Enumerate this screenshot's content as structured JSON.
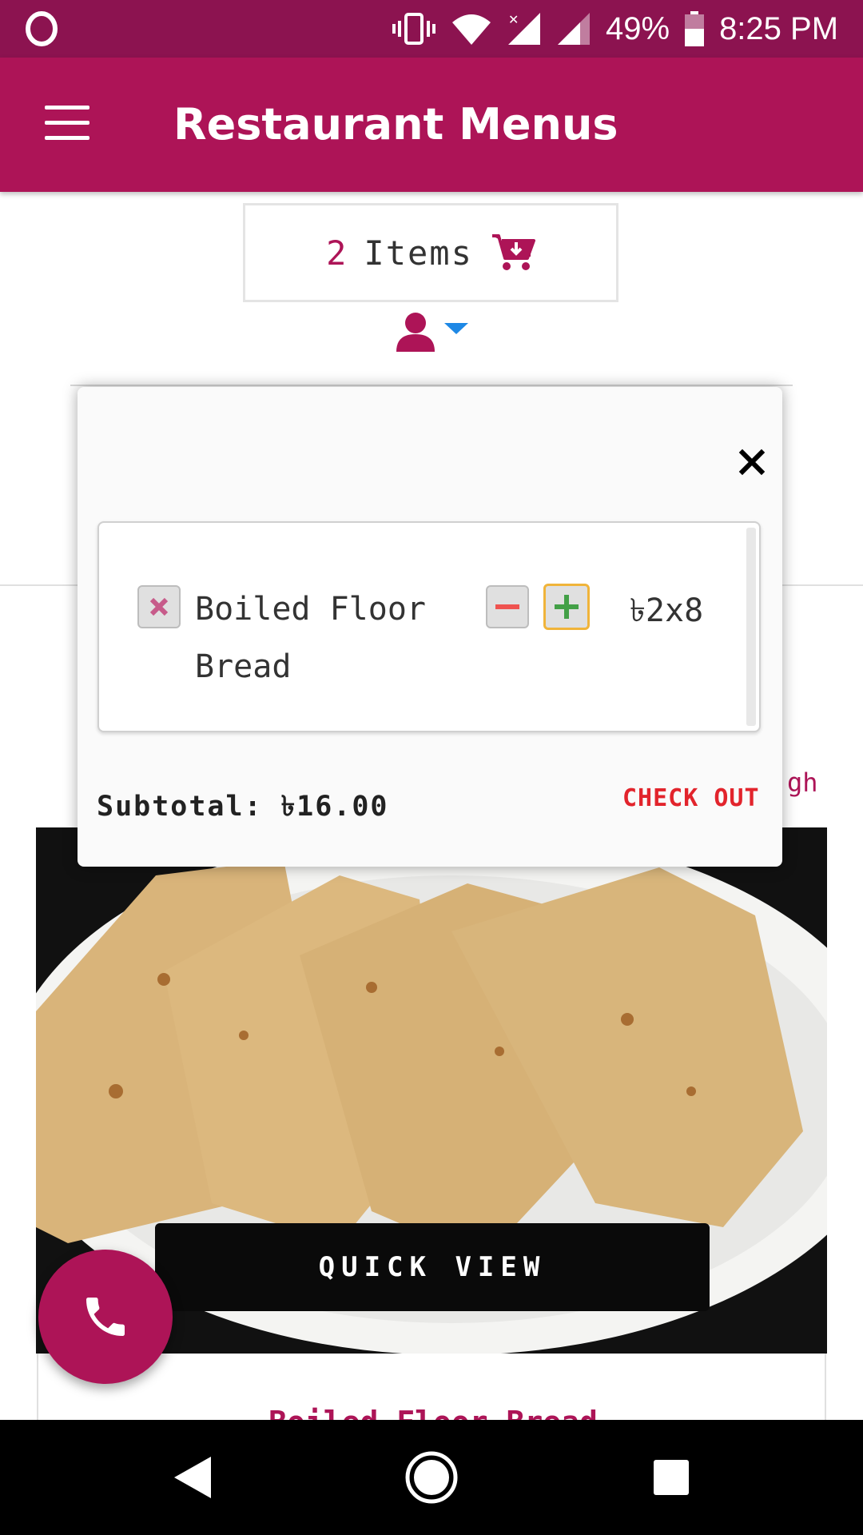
{
  "status_bar": {
    "battery_text": "49%",
    "time": "8:25 PM",
    "color": "#8c1350"
  },
  "app_bar": {
    "title": "Restaurant Menus",
    "menu_icon": "hamburger-menu-icon",
    "color": "#ad1457"
  },
  "cart": {
    "count": "2",
    "label": "Items",
    "icon": "cart-add-icon"
  },
  "user_menu": {
    "icon": "user-icon",
    "dropdown_icon": "caret-down-icon"
  },
  "cart_popup": {
    "items": [
      {
        "name": "Boiled Floor Bread",
        "price": "৳2x8"
      }
    ],
    "subtotal": "Subtotal: ৳16.00",
    "checkout_label": "CHECK OUT"
  },
  "background": {
    "peek_text": "gh",
    "quick_view_label": "QUICK VIEW",
    "card_title": "Boiled Floor Bread"
  },
  "fab": {
    "icon": "phone-icon"
  },
  "nav": {
    "back_icon": "back-icon",
    "home_icon": "home-icon",
    "recents_icon": "recents-icon"
  }
}
